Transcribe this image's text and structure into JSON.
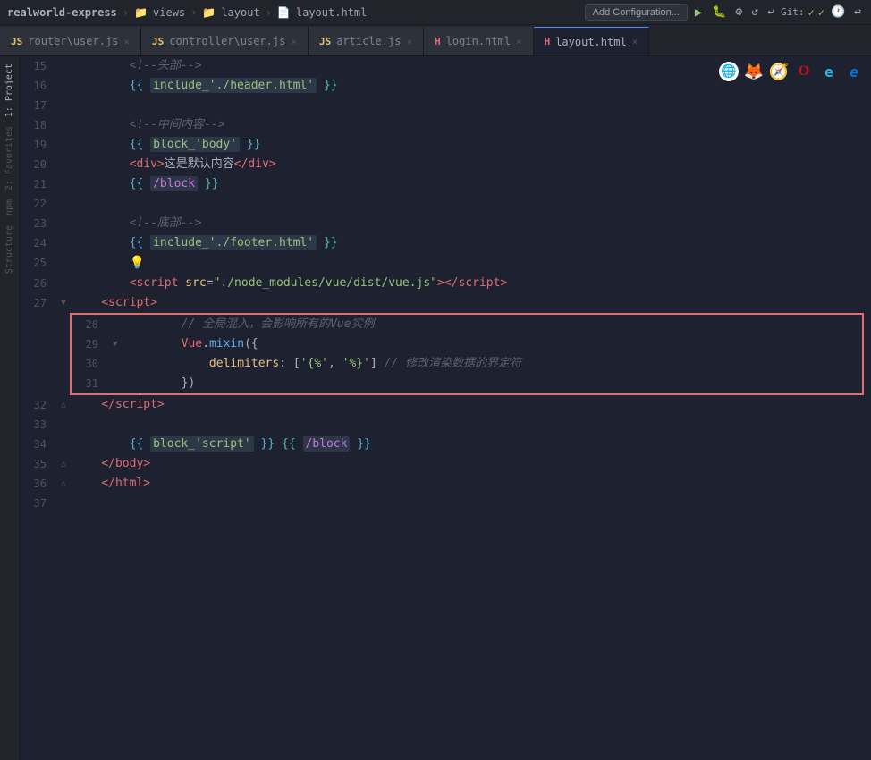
{
  "titleBar": {
    "project": "realworld-express",
    "breadcrumbs": [
      "views",
      "layout",
      "layout.html"
    ],
    "configBtn": "Add Configuration...",
    "git": "Git:",
    "gitIcons": [
      "✓",
      "✓"
    ]
  },
  "tabs": [
    {
      "id": "router-user",
      "label": "router\\user.js",
      "type": "js",
      "active": false
    },
    {
      "id": "controller-user",
      "label": "controller\\user.js",
      "type": "js",
      "active": false
    },
    {
      "id": "article",
      "label": "article.js",
      "type": "js",
      "active": false
    },
    {
      "id": "login",
      "label": "login.html",
      "type": "html",
      "active": false
    },
    {
      "id": "layout",
      "label": "layout.html",
      "type": "html",
      "active": true
    }
  ],
  "sidebar": {
    "items": [
      {
        "id": "project",
        "label": "1: Project",
        "active": false
      },
      {
        "id": "favorites",
        "label": "2: Favorites",
        "active": false
      },
      {
        "id": "npm",
        "label": "npm",
        "active": false
      },
      {
        "id": "structure",
        "label": "Structure",
        "active": false
      }
    ]
  },
  "lines": [
    {
      "num": 15,
      "content": "comment_head",
      "indent": 2
    },
    {
      "num": 16,
      "content": "include_header",
      "indent": 2
    },
    {
      "num": 17,
      "content": "empty"
    },
    {
      "num": 18,
      "content": "comment_middle",
      "indent": 2
    },
    {
      "num": 19,
      "content": "block_body",
      "indent": 2
    },
    {
      "num": 20,
      "content": "div_default",
      "indent": 2
    },
    {
      "num": 21,
      "content": "endblock",
      "indent": 2
    },
    {
      "num": 22,
      "content": "empty"
    },
    {
      "num": 23,
      "content": "comment_footer",
      "indent": 2
    },
    {
      "num": 24,
      "content": "include_footer",
      "indent": 2
    },
    {
      "num": 25,
      "content": "bulb",
      "indent": 2
    },
    {
      "num": 26,
      "content": "script_src",
      "indent": 2
    },
    {
      "num": 27,
      "content": "script_open",
      "indent": 1,
      "fold": true
    },
    {
      "num": 28,
      "content": "comment_global",
      "indent": 3,
      "inBlock": true
    },
    {
      "num": 29,
      "content": "vue_mixin",
      "indent": 3,
      "inBlock": true,
      "fold": true
    },
    {
      "num": 30,
      "content": "delimiters",
      "indent": 4,
      "inBlock": true
    },
    {
      "num": 31,
      "content": "close_paren",
      "indent": 3,
      "inBlock": true
    },
    {
      "num": 32,
      "content": "script_close",
      "indent": 1,
      "fold": true
    },
    {
      "num": 33,
      "content": "empty"
    },
    {
      "num": 34,
      "content": "block_script",
      "indent": 2
    },
    {
      "num": 35,
      "content": "close_body",
      "indent": 1,
      "fold": true
    },
    {
      "num": 36,
      "content": "close_html",
      "indent": 1,
      "fold": true
    },
    {
      "num": 37,
      "content": "empty"
    }
  ],
  "browserIcons": [
    "🌐",
    "🦊",
    "🧭",
    "O",
    "e",
    "e"
  ],
  "colors": {
    "bg": "#1e2130",
    "tabBg": "#21252b",
    "activeTab": "#1e2130",
    "redBorder": "#e06c75",
    "accent": "#528bff"
  }
}
